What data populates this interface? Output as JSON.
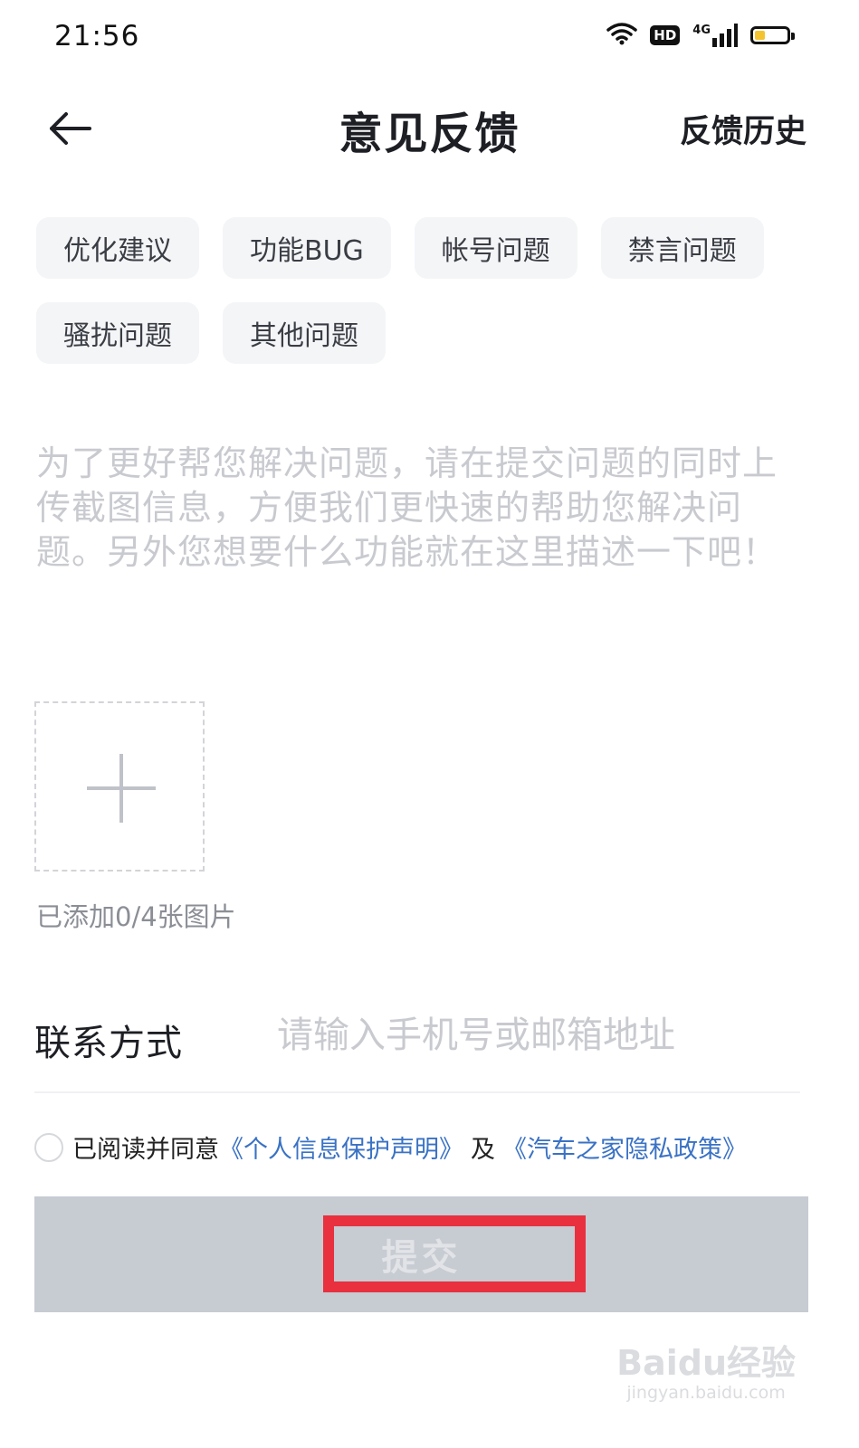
{
  "status_bar": {
    "time": "21:56",
    "hd": "HD",
    "network": "4G",
    "battery_level": 0.3,
    "battery_color": "#f4c430"
  },
  "header": {
    "back_icon": "arrow-left-icon",
    "title": "意见反馈",
    "history_link": "反馈历史"
  },
  "tags": [
    "优化建议",
    "功能BUG",
    "帐号问题",
    "禁言问题",
    "骚扰问题",
    "其他问题"
  ],
  "description": {
    "placeholder": "为了更好帮您解决问题，请在提交问题的同时上传截图信息，方便我们更快速的帮助您解决问题。另外您想要什么功能就在这里描述一下吧！"
  },
  "upload": {
    "icon": "plus-icon",
    "count_text": "已添加0/4张图片"
  },
  "contact": {
    "label": "联系方式",
    "placeholder": "请输入手机号或邮箱地址",
    "value": ""
  },
  "agreement": {
    "checked": false,
    "prefix": "已阅读并同意",
    "link1": "《个人信息保护声明》",
    "and": "及",
    "link2": "《汽车之家隐私政策》",
    "link_color": "#3a72c4"
  },
  "submit": {
    "label": "提交",
    "highlight_color": "#e8303f"
  },
  "watermark": {
    "logo": "Baidu经验",
    "url": "jingyan.baidu.com"
  }
}
